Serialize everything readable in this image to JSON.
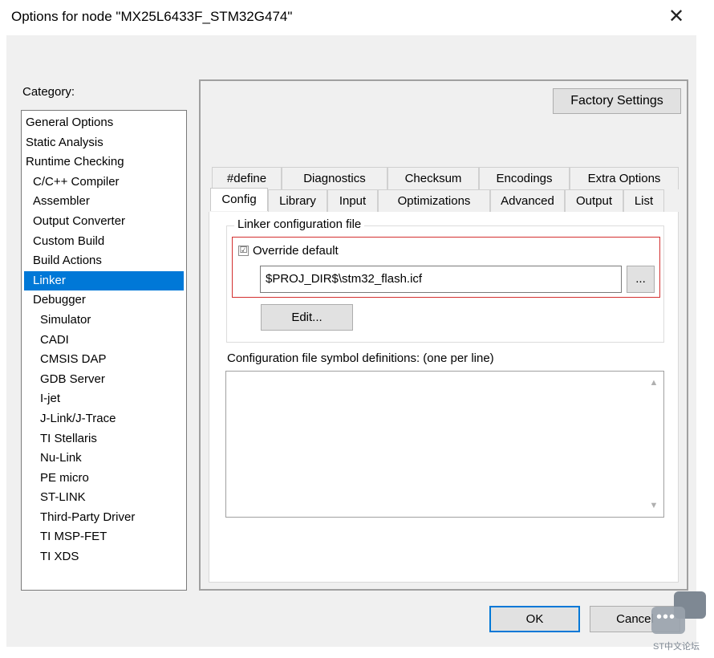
{
  "window": {
    "title": "Options for node \"MX25L6433F_STM32G474\"",
    "close_glyph": "✕"
  },
  "category": {
    "label": "Category:",
    "items": [
      {
        "label": "General Options",
        "level": 0
      },
      {
        "label": "Static Analysis",
        "level": 0
      },
      {
        "label": "Runtime Checking",
        "level": 0
      },
      {
        "label": "C/C++ Compiler",
        "level": 1
      },
      {
        "label": "Assembler",
        "level": 1
      },
      {
        "label": "Output Converter",
        "level": 1
      },
      {
        "label": "Custom Build",
        "level": 1
      },
      {
        "label": "Build Actions",
        "level": 1
      },
      {
        "label": "Linker",
        "level": 1,
        "selected": true
      },
      {
        "label": "Debugger",
        "level": 1
      },
      {
        "label": "Simulator",
        "level": 2
      },
      {
        "label": "CADI",
        "level": 2
      },
      {
        "label": "CMSIS DAP",
        "level": 2
      },
      {
        "label": "GDB Server",
        "level": 2
      },
      {
        "label": "I-jet",
        "level": 2
      },
      {
        "label": "J-Link/J-Trace",
        "level": 2
      },
      {
        "label": "TI Stellaris",
        "level": 2
      },
      {
        "label": "Nu-Link",
        "level": 2
      },
      {
        "label": "PE micro",
        "level": 2
      },
      {
        "label": "ST-LINK",
        "level": 2
      },
      {
        "label": "Third-Party Driver",
        "level": 2
      },
      {
        "label": "TI MSP-FET",
        "level": 2
      },
      {
        "label": "TI XDS",
        "level": 2
      }
    ]
  },
  "factory_settings_label": "Factory Settings",
  "tabs_row1": [
    "#define",
    "Diagnostics",
    "Checksum",
    "Encodings",
    "Extra Options"
  ],
  "tabs_row2": [
    "Config",
    "Library",
    "Input",
    "Optimizations",
    "Advanced",
    "Output",
    "List"
  ],
  "active_tab": "Config",
  "config": {
    "group_title": "Linker configuration file",
    "override_checked": true,
    "check_glyph": "☑",
    "override_label": "Override default",
    "file_path": "$PROJ_DIR$\\stm32_flash.icf",
    "browse_label": "...",
    "edit_label": "Edit...",
    "symbols_label": "Configuration file symbol definitions: (one per line)",
    "symbols_value": ""
  },
  "buttons": {
    "ok": "OK",
    "cancel": "Cancel"
  },
  "watermark": {
    "dots": "•••",
    "text": "ST中文论坛"
  },
  "colors": {
    "selection": "#0078d7",
    "highlight_border": "#d32f2f",
    "dialog_bg": "#f0f0f0"
  }
}
